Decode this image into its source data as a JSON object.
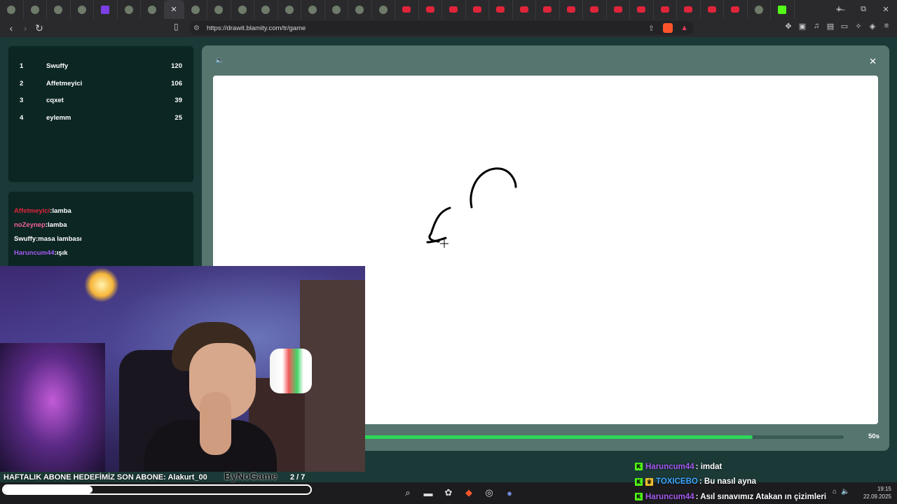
{
  "browser": {
    "tab_count_icons": 34,
    "url": "https://drawit.blamity.com/tr/game",
    "new_tab_label": "+",
    "min_label": "—",
    "max_label": "⧉",
    "close_label": "✕"
  },
  "scoreboard": [
    {
      "rank": "1",
      "name": "Swuffy",
      "points": "120"
    },
    {
      "rank": "2",
      "name": "Affetmeyici",
      "points": "106"
    },
    {
      "rank": "3",
      "name": "cqxet",
      "points": "39"
    },
    {
      "rank": "4",
      "name": "eylemm",
      "points": "25"
    }
  ],
  "chat": [
    {
      "user": "Affetmeyici",
      "text": ":lamba",
      "color": "#e0243a"
    },
    {
      "user": "noZeynep",
      "text": ":lamba",
      "color": "#f2619a"
    },
    {
      "user": "Swuffy",
      "text": ":masa lambası",
      "color": "#ffffff"
    },
    {
      "user": "Haruncum44",
      "text": ":ışık",
      "color": "#a45bf0"
    }
  ],
  "game": {
    "speaker_icon": "speaker-icon",
    "close_label": "✕",
    "timer_label": "50s",
    "timer_progress": 0.855,
    "accent_color": "#2bd957"
  },
  "stream": {
    "goal_text": "HAFTALIK ABONE HEDEFİMİZ SON ABONE: Alakurt_00",
    "logo_text": "ByNoGame",
    "goal_count": "2  / 7",
    "goal_progress": 0.29
  },
  "kick_chat": [
    {
      "user": "Haruncum44",
      "text": ": imdat",
      "color": "#a45bf0",
      "badges": [
        "kick"
      ]
    },
    {
      "user": "TOXICEBO",
      "text": ": Bu nasıl ayna",
      "color": "#3ea5ff",
      "badges": [
        "kick",
        "gold"
      ]
    },
    {
      "user": "Haruncum44",
      "text": ": Asıl sınavımız Atakan ın çizimleri",
      "color": "#a45bf0",
      "badges": [
        "kick"
      ]
    }
  ],
  "clock": {
    "time": "19:15",
    "date": "22.09.2025"
  }
}
